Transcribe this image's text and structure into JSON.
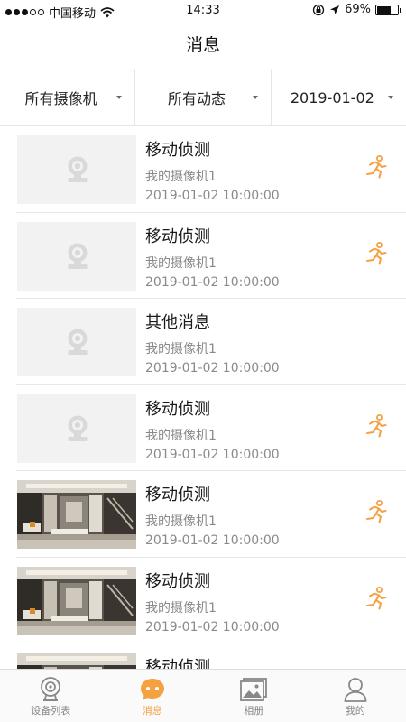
{
  "status_bar": {
    "carrier": "中国移动",
    "time": "14:33",
    "battery": "69%",
    "battery_level": 0.69
  },
  "header": {
    "title": "消息"
  },
  "filters": [
    {
      "label": "所有摄像机"
    },
    {
      "label": "所有动态"
    },
    {
      "label": "2019-01-02"
    }
  ],
  "messages": [
    {
      "title": "移动侦测",
      "camera": "我的摄像机1",
      "time": "2019-01-02 10:00:00",
      "thumbnail": "placeholder",
      "motion_icon": true
    },
    {
      "title": "移动侦测",
      "camera": "我的摄像机1",
      "time": "2019-01-02 10:00:00",
      "thumbnail": "placeholder",
      "motion_icon": true
    },
    {
      "title": "其他消息",
      "camera": "我的摄像机1",
      "time": "2019-01-02 10:00:00",
      "thumbnail": "placeholder",
      "motion_icon": false
    },
    {
      "title": "移动侦测",
      "camera": "我的摄像机1",
      "time": "2019-01-02 10:00:00",
      "thumbnail": "placeholder",
      "motion_icon": true
    },
    {
      "title": "移动侦测",
      "camera": "我的摄像机1",
      "time": "2019-01-02 10:00:00",
      "thumbnail": "room-photo",
      "motion_icon": true
    },
    {
      "title": "移动侦测",
      "camera": "我的摄像机1",
      "time": "2019-01-02 10:00:00",
      "thumbnail": "room-photo",
      "motion_icon": true
    },
    {
      "title": "移动侦测",
      "camera": "",
      "time": "",
      "thumbnail": "room-photo",
      "motion_icon": false
    }
  ],
  "tabbar": {
    "tabs": [
      {
        "label": "设备列表",
        "icon": "camera-icon",
        "active": false
      },
      {
        "label": "消息",
        "icon": "message-bubble-icon",
        "active": true
      },
      {
        "label": "相册",
        "icon": "album-icon",
        "active": false
      },
      {
        "label": "我的",
        "icon": "person-icon",
        "active": false
      }
    ]
  },
  "colors": {
    "accent": "#f5a142",
    "muted_text": "#8a8a8a",
    "divider": "#e6e6e6",
    "placeholder_bg": "#f2f2f2"
  }
}
